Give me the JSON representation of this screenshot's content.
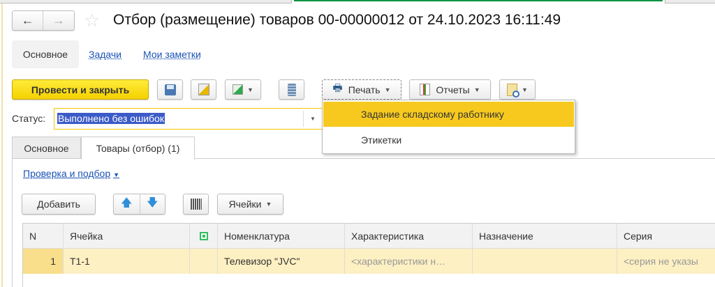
{
  "window": {
    "title": "Отбор (размещение) товаров 00-00000012 от 24.10.2023 16:11:49"
  },
  "nav": {
    "back": "←",
    "forward": "→"
  },
  "section_tabs": [
    {
      "label": "Основное"
    },
    {
      "label": "Задачи"
    },
    {
      "label": "Мои заметки"
    }
  ],
  "toolbar": {
    "post_close": "Провести и закрыть",
    "print": "Печать",
    "reports": "Отчеты"
  },
  "print_menu": {
    "items": [
      {
        "label": "Задание складскому работнику"
      },
      {
        "label": "Этикетки"
      }
    ]
  },
  "status": {
    "label": "Статус:",
    "value": "Выполнено без ошибок"
  },
  "tabs": [
    {
      "label": "Основное"
    },
    {
      "label": "Товары (отбор) (1)"
    }
  ],
  "check_link": "Проверка и подбор",
  "table_toolbar": {
    "add": "Добавить",
    "cells": "Ячейки"
  },
  "table": {
    "columns": [
      "N",
      "Ячейка",
      "",
      "Номенклатура",
      "Характеристика",
      "Назначение",
      "Серия"
    ],
    "rows": [
      {
        "n": "1",
        "cell": "Т1-1",
        "mark": "",
        "item": "Телевизор \"JVC\"",
        "characteristic": "<характеристики н…",
        "purpose": "",
        "series": "<серия не указы"
      }
    ]
  },
  "colors": {
    "accent": "#f5d100",
    "selection": "#3b5bc8",
    "row_highlight": "#fdf0c2",
    "link": "#1a52b5"
  }
}
